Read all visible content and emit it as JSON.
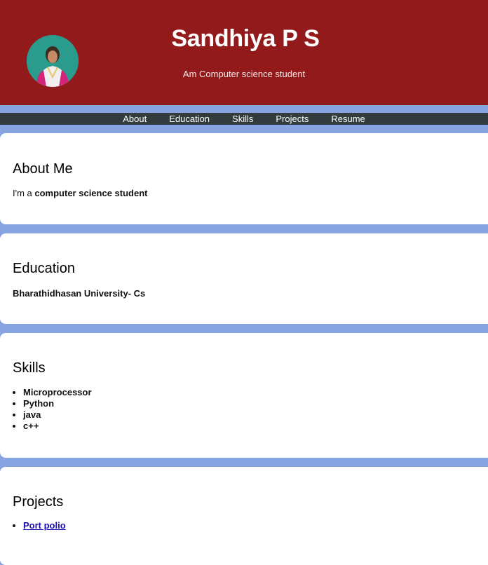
{
  "header": {
    "name": "Sandhiya P S",
    "tagline": "Am Computer science student"
  },
  "nav": [
    "About",
    "Education",
    "Skills",
    "Projects",
    "Resume"
  ],
  "about": {
    "heading": "About Me",
    "prefix": "I'm a ",
    "emphasis": "computer science student"
  },
  "education": {
    "heading": "Education",
    "text": "Bharathidhasan University- Cs"
  },
  "skills": {
    "heading": "Skills",
    "items": [
      "Microprocessor",
      "Python",
      "java",
      "c++"
    ]
  },
  "projects": {
    "heading": "Projects",
    "items": [
      "Port polio"
    ]
  },
  "colors": {
    "header": "#921a1b",
    "nav": "#333b3e",
    "background": "#87a3e0",
    "link": "#1a0dab"
  }
}
